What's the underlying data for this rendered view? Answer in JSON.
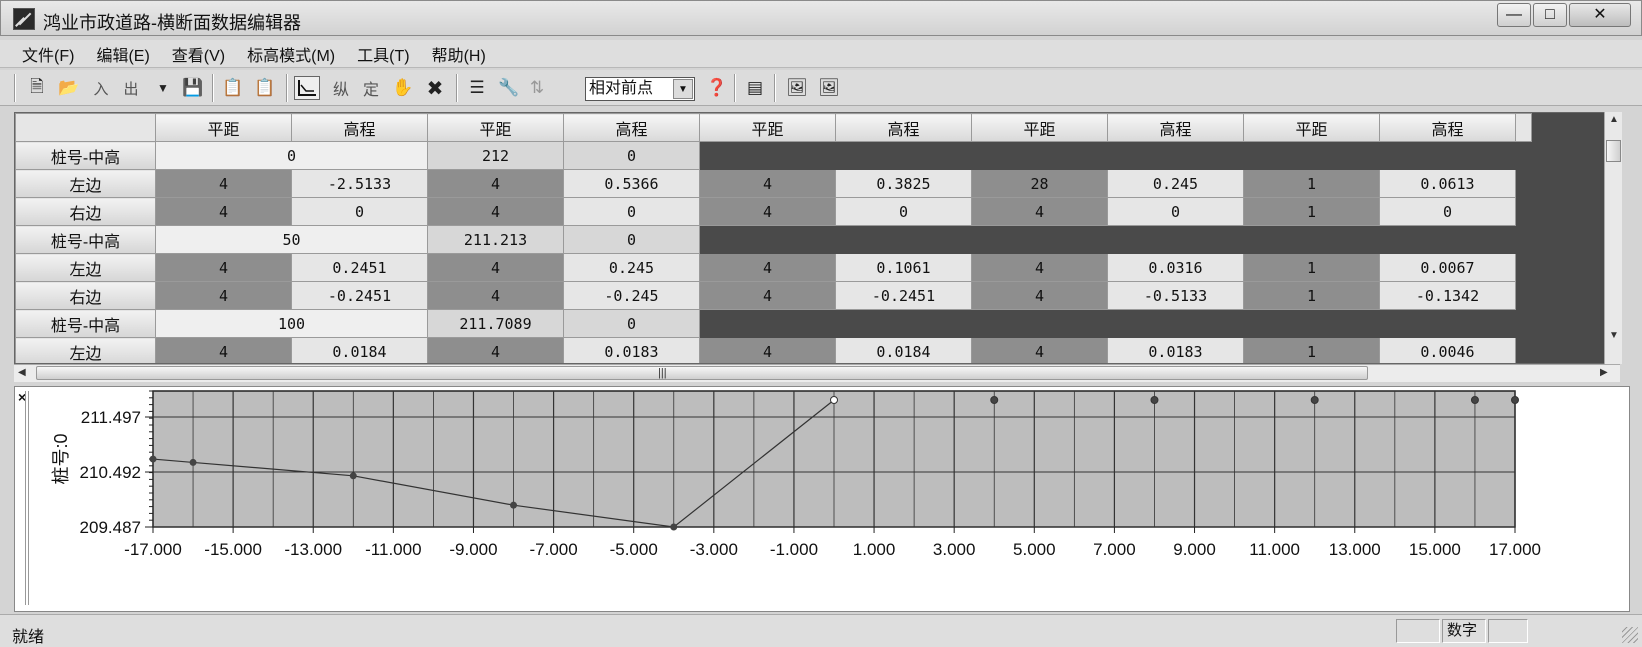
{
  "window": {
    "title": "鸿业市政道路-横断面数据编辑器"
  },
  "menu": [
    "文件(F)",
    "编辑(E)",
    "查看(V)",
    "标高模式(M)",
    "工具(T)",
    "帮助(H)"
  ],
  "toolbar": {
    "in_label": "入",
    "out_label": "出",
    "vert_label": "纵",
    "fix_label": "定",
    "mode_select": "相对前点"
  },
  "grid": {
    "headers": [
      "平距",
      "高程",
      "平距",
      "高程",
      "平距",
      "高程",
      "平距",
      "高程",
      "平距",
      "高程"
    ],
    "rows": [
      {
        "label": "桩号-中高",
        "type": "station",
        "cells": [
          "0",
          "212",
          "0"
        ]
      },
      {
        "label": "左边",
        "type": "data",
        "cells": [
          "4",
          "-2.5133",
          "4",
          "0.5366",
          "4",
          "0.3825",
          "28",
          "0.245",
          "1",
          "0.0613"
        ]
      },
      {
        "label": "右边",
        "type": "data",
        "cells": [
          "4",
          "0",
          "4",
          "0",
          "4",
          "0",
          "4",
          "0",
          "1",
          "0"
        ]
      },
      {
        "label": "桩号-中高",
        "type": "station",
        "cells": [
          "50",
          "211.213",
          "0"
        ]
      },
      {
        "label": "左边",
        "type": "data",
        "cells": [
          "4",
          "0.2451",
          "4",
          "0.245",
          "4",
          "0.1061",
          "4",
          "0.0316",
          "1",
          "0.0067"
        ]
      },
      {
        "label": "右边",
        "type": "data",
        "cells": [
          "4",
          "-0.2451",
          "4",
          "-0.245",
          "4",
          "-0.2451",
          "4",
          "-0.5133",
          "1",
          "-0.1342"
        ]
      },
      {
        "label": "桩号-中高",
        "type": "station",
        "cells": [
          "100",
          "211.7089",
          "0"
        ]
      },
      {
        "label": "左边",
        "type": "data",
        "cells": [
          "4",
          "0.0184",
          "4",
          "0.0183",
          "4",
          "0.0184",
          "4",
          "0.0183",
          "1",
          "0.0046"
        ]
      }
    ]
  },
  "chart_data": {
    "type": "line",
    "ylabel": "桩号:0",
    "xlim": [
      -17,
      17
    ],
    "ylim": [
      209.487,
      211.497
    ],
    "yticks": [
      "211.497",
      "210.492",
      "209.487"
    ],
    "xticks": [
      "-17.000",
      "-15.000",
      "-13.000",
      "-11.000",
      "-9.000",
      "-7.000",
      "-5.000",
      "-3.000",
      "-1.000",
      "1.000",
      "3.000",
      "5.000",
      "7.000",
      "9.000",
      "11.000",
      "13.000",
      "15.000",
      "17.000"
    ],
    "line_points": [
      {
        "x": -17,
        "y": 210.728
      },
      {
        "x": -16,
        "y": 210.667
      },
      {
        "x": -12,
        "y": 210.422
      },
      {
        "x": -8,
        "y": 209.886
      },
      {
        "x": -4,
        "y": 209.487
      },
      {
        "x": 0,
        "y": 212.0
      }
    ],
    "markers_right": [
      {
        "x": 0,
        "y": 212.0,
        "open": true
      },
      {
        "x": 4,
        "y": 212.0
      },
      {
        "x": 8,
        "y": 212.0
      },
      {
        "x": 12,
        "y": 212.0
      },
      {
        "x": 16,
        "y": 212.0
      },
      {
        "x": 17,
        "y": 212.0
      }
    ],
    "grid": true
  },
  "status": {
    "text": "就绪",
    "num": "数字"
  }
}
